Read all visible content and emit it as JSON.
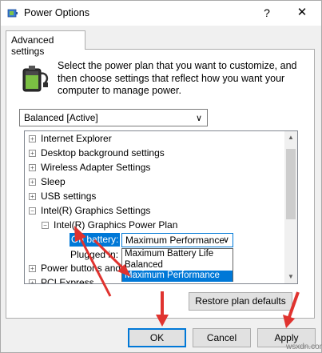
{
  "window": {
    "title": "Power Options",
    "help_glyph": "?",
    "close_glyph": "✕",
    "icon": "power-options-icon"
  },
  "tab": {
    "label": "Advanced settings"
  },
  "description": {
    "line1": "Select the power plan that you want to customize, and",
    "line2": "then choose settings that reflect how you want your",
    "line3": "computer to manage power."
  },
  "plan_select": {
    "value": "Balanced [Active]",
    "chevron": "∨"
  },
  "tree": {
    "expand_plus": "+",
    "expand_minus": "−",
    "items": [
      {
        "label": "Internet Explorer"
      },
      {
        "label": "Desktop background settings"
      },
      {
        "label": "Wireless Adapter Settings"
      },
      {
        "label": "Sleep"
      },
      {
        "label": "USB settings"
      },
      {
        "label": "Intel(R) Graphics Settings"
      },
      {
        "label": "Intel(R) Graphics Power Plan"
      },
      {
        "label": "On battery:"
      },
      {
        "label": "Plugged in:"
      },
      {
        "label": "Power buttons and lid"
      },
      {
        "label": "PCI Express"
      }
    ]
  },
  "dropdown": {
    "value": "Maximum Performance",
    "chevron": "∨",
    "options": [
      "Maximum Battery Life",
      "Balanced",
      "Maximum Performance"
    ],
    "selected_index": 2
  },
  "buttons": {
    "restore": "Restore plan defaults",
    "ok": "OK",
    "cancel": "Cancel",
    "apply": "Apply"
  },
  "watermark": "wsxdn.com",
  "colors": {
    "accent": "#0078d7",
    "arrow": "#e0332f"
  }
}
